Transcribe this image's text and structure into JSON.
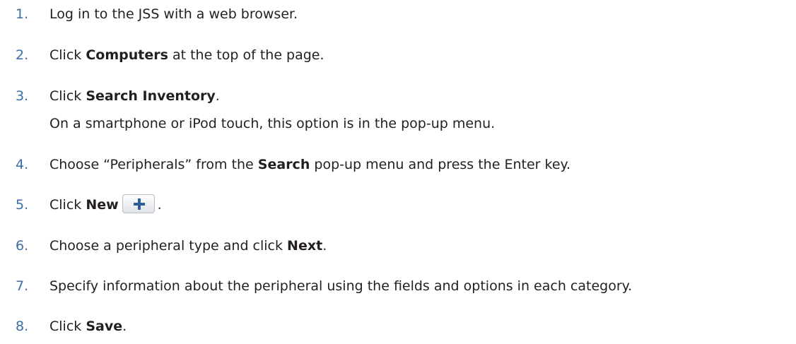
{
  "steps": [
    {
      "num": "1.",
      "text": "Log in to the JSS with a web browser."
    },
    {
      "num": "2.",
      "pre": "Click ",
      "bold": "Computers",
      "post": " at the top of the page."
    },
    {
      "num": "3.",
      "pre": "Click ",
      "bold": "Search Inventory",
      "post": ".",
      "note": "On a smartphone or iPod touch, this option is in the pop-up menu."
    },
    {
      "num": "4.",
      "pre": "Choose “Peripherals” from the ",
      "bold": "Search",
      "post": " pop-up menu and press the Enter key."
    },
    {
      "num": "5.",
      "pre": "Click ",
      "bold": "New",
      "post": "."
    },
    {
      "num": "6.",
      "pre": "Choose a peripheral type and click ",
      "bold": "Next",
      "post": "."
    },
    {
      "num": "7.",
      "text": "Specify information about the peripheral using the fields and options in each category."
    },
    {
      "num": "8.",
      "pre": "Click ",
      "bold": "Save",
      "post": "."
    }
  ],
  "icons": {
    "new_button_icon": "plus-icon"
  },
  "colors": {
    "step_number": "#3a6ea5",
    "text": "#231f20",
    "plus_icon": "#2f5f9a"
  }
}
